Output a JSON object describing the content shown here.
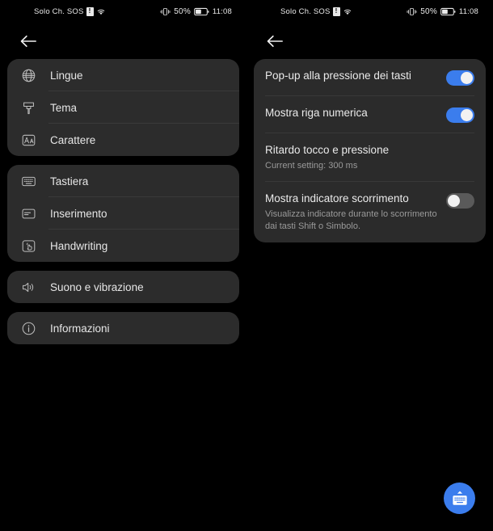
{
  "status_bar": {
    "carrier": "Solo Ch. SOS",
    "sim_badge": "!",
    "wifi_icon": "wifi-icon",
    "vibrate_icon": "vibrate-icon",
    "battery_percent": "50%",
    "time": "11:08"
  },
  "colors": {
    "background": "#000000",
    "card": "#2c2c2c",
    "accent": "#3b7ded",
    "toggle_off": "#5a5a5a",
    "text_primary": "#e6e6e6",
    "text_secondary": "#9a9a9a"
  },
  "left_panel": {
    "back_label": "Indietro",
    "groups": [
      {
        "items": [
          {
            "label": "Lingue",
            "icon": "globe-icon"
          },
          {
            "label": "Tema",
            "icon": "paint-brush-icon"
          },
          {
            "label": "Carattere",
            "icon": "font-size-icon"
          }
        ]
      },
      {
        "items": [
          {
            "label": "Tastiera",
            "icon": "keyboard-icon"
          },
          {
            "label": "Inserimento",
            "icon": "input-card-icon"
          },
          {
            "label": "Handwriting",
            "icon": "handwriting-icon"
          }
        ]
      },
      {
        "items": [
          {
            "label": "Suono e vibrazione",
            "icon": "speaker-icon"
          }
        ]
      },
      {
        "items": [
          {
            "label": "Informazioni",
            "icon": "info-icon"
          }
        ]
      }
    ]
  },
  "right_panel": {
    "back_label": "Indietro",
    "settings": [
      {
        "title": "Pop-up alla pressione dei tasti",
        "subtitle": "",
        "control": "toggle",
        "state": "on"
      },
      {
        "title": "Mostra riga numerica",
        "subtitle": "",
        "control": "toggle",
        "state": "on"
      },
      {
        "title": "Ritardo tocco e pressione",
        "subtitle": "Current setting: 300 ms",
        "control": "none",
        "state": ""
      },
      {
        "title": "Mostra indicatore scorrimento",
        "subtitle": "Visualizza indicatore durante lo scorrimento dai tasti Shift o Simbolo.",
        "control": "toggle",
        "state": "off"
      }
    ]
  },
  "fab": {
    "icon": "keyboard-show-icon",
    "label": "Mostra tastiera"
  }
}
